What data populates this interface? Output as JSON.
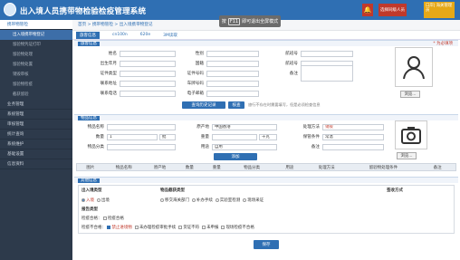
{
  "header": {
    "title": "出入境人员携带物检验检疫管理系统",
    "user": "选择同级人员",
    "dept": "口岸|\n海关管理员",
    "bell": "🔔",
    "fullscreen": {
      "pre": "按",
      "key": "F11",
      "post": "即可退出全屏模式"
    }
  },
  "sidebar": {
    "sections": [
      {
        "label": "携带物管检",
        "active": true,
        "items": [
          "出入境携带物登记",
          "留验物凭证打印",
          "留验物处理",
          "留验物处置",
          "销毁审核",
          "留验物检疫",
          "截获留验"
        ]
      },
      {
        "label": "业务管理"
      },
      {
        "label": "系统管理"
      },
      {
        "label": "审核管理"
      },
      {
        "label": "统计查询"
      },
      {
        "label": "系统维护"
      },
      {
        "label": "基础设置"
      },
      {
        "label": "信息资料"
      }
    ]
  },
  "breadcrumb": "首页 > 携带物管检 > 出入境携带物登记",
  "tabs": [
    "旅客信息",
    "cn100n",
    "620e",
    "3M读取"
  ],
  "traveler": {
    "header": "旅客信息",
    "hint": "* 为必填项",
    "fields": {
      "name": "姓名",
      "gender": "性别",
      "flight": "航班号",
      "birth": "出生年月",
      "nationality": "国籍",
      "transport": "航班号",
      "id_type": "证件类型",
      "id_no": "证件号码",
      "remark": "备注",
      "address": "联系地址",
      "plate": "车牌号码",
      "phone": "联系电话",
      "email": "电子邮箱"
    },
    "btn_history": "查询历史记录",
    "btn_verify": "核查",
    "note": "旅行不存在时需要填写，但是必须检查信息"
  },
  "photo_btn": "浏览...",
  "goods": {
    "header": "物品信息",
    "fields": {
      "name": "物品名称",
      "origin": "原产地",
      "origin_val": "中国香港",
      "process": "处理方法",
      "process_val": "销毁",
      "qty": "数量",
      "qty_val": "1",
      "unit": "批",
      "weight": "重量",
      "wunit": "千克",
      "store": "保管条件",
      "store_val": "常温",
      "type": "物品分类",
      "use": "用途",
      "use_val": "自用",
      "remark": "备注"
    },
    "add_btn": "添加",
    "columns": [
      "图片",
      "物品名称",
      "原产地",
      "数量",
      "重量",
      "物品分类",
      "用途",
      "处理方法",
      "留验物处理条件",
      "备注"
    ]
  },
  "entry": {
    "header": "其他信息",
    "col_direction": "出入境类型",
    "col_period": "物品截获类型",
    "col_send": "签收方式",
    "opts_dir": [
      "入境",
      "出境"
    ],
    "opts_period": [
      "移交海关部门",
      "补办手续",
      "实验室检测",
      "现场采证"
    ],
    "row2": "报告类型",
    "row3_label": "检疫合格：",
    "row3_opts": [
      "检疫合格"
    ],
    "row4_label": "检疫不合格：",
    "row4_opts": [
      "禁止进境物",
      "未办理检疫审批手续",
      "货证不符",
      "未申报",
      "现场检疫不合格"
    ]
  },
  "save": "保存"
}
